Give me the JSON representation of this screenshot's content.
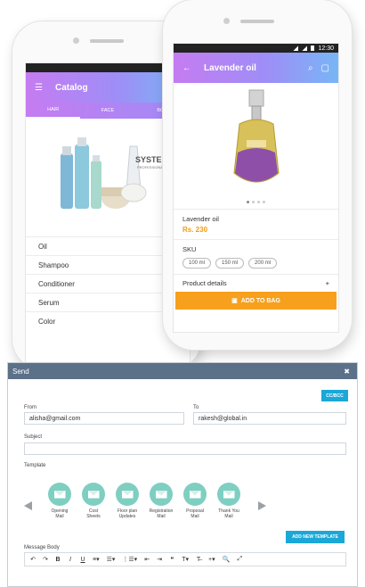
{
  "status_bar": {
    "time": "12:30"
  },
  "catalog": {
    "title": "Catalog",
    "tabs": [
      "HAIR",
      "FACE",
      "BOD"
    ],
    "brand_text": "SYSTEM",
    "brand_sub": "PROFESSIONAL",
    "items": [
      "Oil",
      "Shampoo",
      "Conditioner",
      "Serum",
      "Color"
    ]
  },
  "product": {
    "title": "Lavender oil",
    "name": "Lavender oil",
    "price": "Rs. 230",
    "sku_label": "SKU",
    "sku_options": [
      "100 ml",
      "150 ml",
      "200 ml"
    ],
    "details_label": "Product details",
    "details_toggle": "+",
    "add_to_bag": "ADD TO BAG",
    "image_dots": 4,
    "active_dot": 0
  },
  "send": {
    "title": "Send",
    "close": "✖",
    "cc_bcc": "CC/BCC",
    "from_label": "From",
    "from_value": "alisha@gmail.com",
    "to_label": "To",
    "to_value": "rakesh@global.in",
    "subject_label": "Subject",
    "subject_value": "",
    "template_label": "Template",
    "templates": [
      [
        "Opening",
        "Mail"
      ],
      [
        "Cost",
        "Sheets"
      ],
      [
        "Floor plan",
        "Updates"
      ],
      [
        "Registration",
        "Mail"
      ],
      [
        "Proposal",
        "Mail"
      ],
      [
        "Thank You",
        "Mail"
      ]
    ],
    "add_template": "ADD NEW TEMPLATE",
    "message_label": "Message Body",
    "toolbar": [
      "↶",
      "↷",
      "B",
      "I",
      "U",
      "≡▾",
      "☰▾",
      "⋮☰▾",
      "⇤",
      "⇥",
      "❝",
      "T▾",
      "T̶",
      "+▾",
      "🔍",
      "⤢"
    ]
  },
  "colors": {
    "accent_gradient_start": "#c57cf1",
    "accent_gradient_end": "#78b6f5",
    "price": "#f39c12",
    "bag_button": "#f7a01d",
    "modal_header": "#5b7089",
    "action_button": "#1ba8d8",
    "template_circle": "#7ecfc1"
  }
}
